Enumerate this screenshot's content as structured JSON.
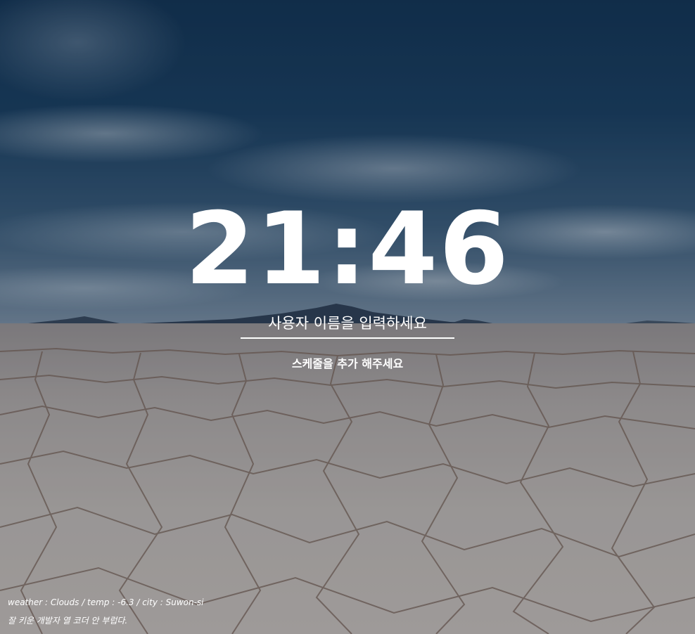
{
  "clock": {
    "time": "21:46"
  },
  "name_form": {
    "placeholder": "사용자 이름을 입력하세요"
  },
  "schedule": {
    "label": "스케줄을 추가 해주세요"
  },
  "weather": {
    "text": "weather : Clouds / temp : -6.3 / city : Suwon-si"
  },
  "quote": {
    "text": "잘 키운 개발자 열 코더 안 부럽다."
  },
  "colors": {
    "text": "#ffffff",
    "sky": "#1d456b",
    "ground": "#c4c0bf"
  }
}
